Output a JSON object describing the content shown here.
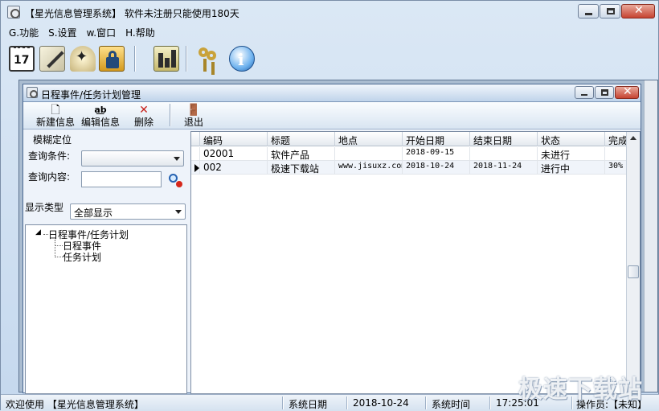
{
  "window": {
    "title": "【星光信息管理系统】 软件未注册只能使用180天"
  },
  "menu": [
    "G.功能",
    "S.设置",
    "w.窗口",
    "H.帮助"
  ],
  "toolbar": {
    "calendar_day": "17"
  },
  "child_window": {
    "title": "日程事件/任务计划管理",
    "buttons": {
      "new": "新建信息",
      "edit": "编辑信息",
      "delete": "删除",
      "exit": "退出"
    }
  },
  "filter": {
    "group_label": "模糊定位",
    "condition_label": "查询条件:",
    "condition_value": "",
    "content_label": "查询内容:",
    "content_value": "",
    "display_type_label": "显示类型",
    "display_type_value": "全部显示"
  },
  "tree": {
    "root": "日程事件/任务计划",
    "children": [
      "日程事件",
      "任务计划"
    ]
  },
  "table": {
    "columns": [
      "编码",
      "标题",
      "地点",
      "开始日期",
      "结束日期",
      "状态",
      "完成"
    ],
    "rows": [
      [
        "02001",
        "软件产品",
        "",
        "2018-09-15",
        "",
        "未进行",
        ""
      ],
      [
        "002",
        "极速下载站",
        "www.jisuxz.com",
        "2018-10-24",
        "2018-11-24",
        "进行中",
        "30%"
      ]
    ]
  },
  "status": {
    "welcome": "欢迎使用 【星光信息管理系统】",
    "date_label": "系统日期",
    "date_value": "2018-10-24",
    "time_label": "系统时间",
    "time_value": "17:25:01",
    "operator": "操作员:【未知】"
  },
  "watermark": "极速下载站"
}
